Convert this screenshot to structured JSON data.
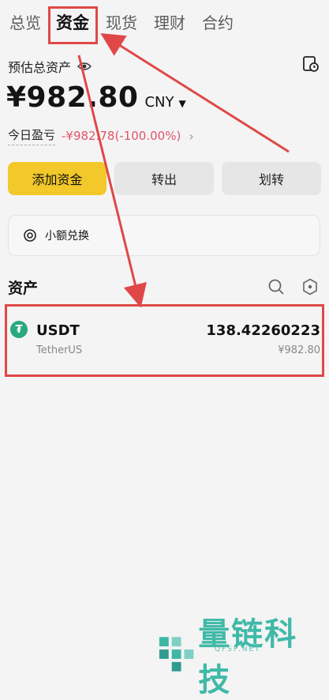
{
  "tabs": [
    "总览",
    "资金",
    "现货",
    "理财",
    "合约"
  ],
  "active_tab": "资金",
  "summary": {
    "label": "预估总资产",
    "total": "¥982.80",
    "currency": "CNY",
    "pnl_label": "今日盈亏",
    "pnl_value": "-¥982.78(-100.00%)"
  },
  "actions": {
    "deposit": "添加资金",
    "withdraw": "转出",
    "transfer": "划转"
  },
  "convert_label": "小额兑换",
  "assets": {
    "title": "资产",
    "items": [
      {
        "symbol": "USDT",
        "name": "TetherUS",
        "amount": "138.42260223",
        "value_cny": "¥982.80"
      }
    ]
  },
  "watermark": {
    "text": "量链科技",
    "site": "QFSP.NET"
  },
  "colors": {
    "accent": "#f2c82a",
    "loss": "#e0556a",
    "highlight": "#e04848",
    "coin": "#2aa880"
  },
  "icons": [
    "eye-icon",
    "history-icon",
    "arrow-right-icon",
    "convert-icon",
    "search-icon",
    "settings-hex-icon",
    "usdt-coin-icon"
  ]
}
